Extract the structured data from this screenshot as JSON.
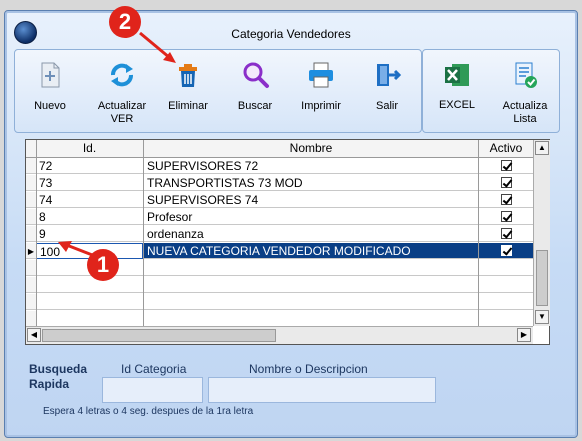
{
  "window": {
    "title": "Categoria Vendedores"
  },
  "toolbar": {
    "nuevo": "Nuevo",
    "actualizar": "Actualizar VER",
    "eliminar": "Eliminar",
    "buscar": "Buscar",
    "imprimir": "Imprimir",
    "salir": "Salir",
    "excel": "EXCEL",
    "actualiza_lista": "Actualiza Lista"
  },
  "grid": {
    "columns": [
      "Id.",
      "Nombre",
      "Activo"
    ],
    "rows": [
      {
        "id": "72",
        "nombre": "SUPERVISORES 72",
        "activo": true
      },
      {
        "id": "73",
        "nombre": "TRANSPORTISTAS 73 MOD",
        "activo": true
      },
      {
        "id": "74",
        "nombre": "SUPERVISORES 74",
        "activo": true
      },
      {
        "id": "8",
        "nombre": "Profesor",
        "activo": true
      },
      {
        "id": "9",
        "nombre": "ordenanza",
        "activo": true
      },
      {
        "id": "100",
        "nombre": "NUEVA CATEGORIA VENDEDOR MODIFICADO",
        "activo": true,
        "selected": true
      }
    ]
  },
  "search": {
    "label_line1": "Busqueda",
    "label_line2": "Rapida",
    "id_label": "Id Categoria",
    "name_label": "Nombre o Descripcion",
    "hint": "Espera 4 letras o 4 seg. despues de la 1ra letra"
  },
  "annotations": {
    "badge1": "1",
    "badge2": "2",
    "color": "#e0241b"
  }
}
